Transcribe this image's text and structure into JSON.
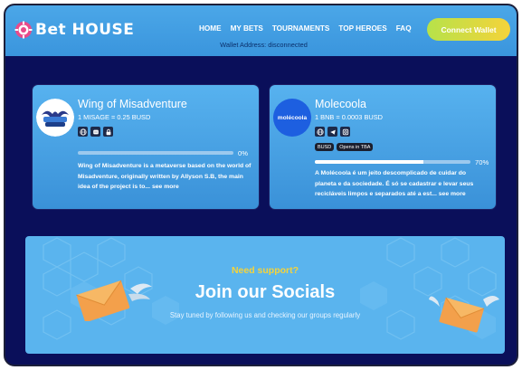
{
  "header": {
    "logo_text": "Bet HOUSE",
    "nav": [
      "HOME",
      "MY BETS",
      "TOURNAMENTS",
      "TOP HEROES",
      "FAQ"
    ],
    "connect_label": "Connect Wallet",
    "wallet_text": "Wallet Address: disconnected"
  },
  "cards": [
    {
      "title": "Wing of Misadventure",
      "rate": "1 MISAGE = 0.25 BUSD",
      "progress_pct": 0,
      "progress_label": "0%",
      "description": "Wing of Misadventure is a metaverse based on the world of Misadventure, originally written by Allyson S.B, the main idea of the project is to...",
      "more": "see more",
      "icons": [
        "globe-icon",
        "discord-icon",
        "lock-icon"
      ]
    },
    {
      "title": "Molecoola",
      "avatar_text": "molécoola",
      "rate": "1 BNB = 0.0003 BUSD",
      "tags": [
        "BUSD",
        "Opens in TBA"
      ],
      "progress_pct": 70,
      "progress_label": "70%",
      "description": "A Molécoola é um jeito descomplicado de cuidar do planeta e da sociedade. É só se cadastrar e levar seus recicláveis limpos e separados até a est...",
      "more": "see more",
      "icons": [
        "globe-icon",
        "telegram-icon",
        "instagram-icon"
      ]
    }
  ],
  "socials": {
    "kicker": "Need support?",
    "title": "Join our Socials",
    "subtitle": "Stay tuned by following us and checking our groups regularly"
  },
  "colors": {
    "background": "#0a0f5a",
    "header": "#3f9ce0",
    "accent_yellow": "#f5d33a",
    "card": "#4aa4e6"
  }
}
